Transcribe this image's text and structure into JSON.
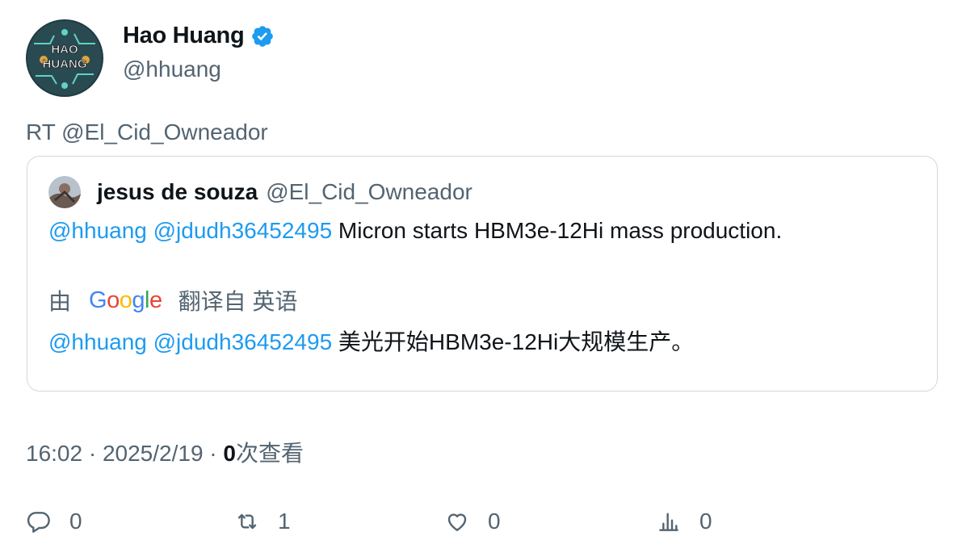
{
  "author": {
    "name": "Hao Huang",
    "handle": "@hhuang",
    "avatar_text_line1": "HAO",
    "avatar_text_line2": "HUANG"
  },
  "retweet_line": "RT @El_Cid_Owneador",
  "quote": {
    "name": "jesus de souza",
    "handle": "@El_Cid_Owneador",
    "mentions": "@hhuang @jdudh36452495",
    "text": " Micron starts HBM3e-12Hi mass production.",
    "translate_prefix": "由",
    "translate_suffix": "翻译自 英语",
    "translated_text": " 美光开始HBM3e-12Hi大规模生产。"
  },
  "meta": {
    "time_date": "16:02 · 2025/2/19 · ",
    "views_count": "0",
    "views_label": "次查看"
  },
  "actions": {
    "replies": "0",
    "retweets": "1",
    "likes": "0",
    "views": "0"
  },
  "colors": {
    "accent": "#1d9bf0",
    "secondary_text": "#536471",
    "border": "#cfd9de"
  }
}
